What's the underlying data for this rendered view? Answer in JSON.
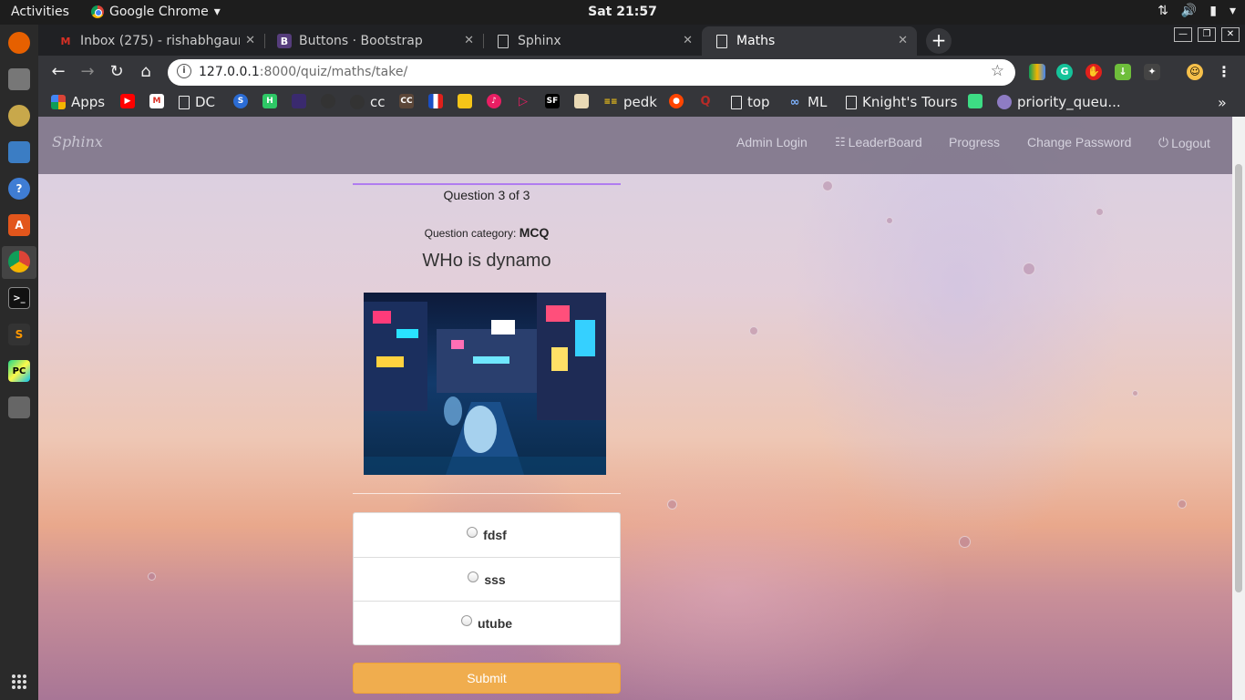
{
  "system": {
    "activities": "Activities",
    "app_menu": "Google Chrome",
    "clock": "Sat 21:57"
  },
  "browser": {
    "tabs": [
      {
        "title": "Inbox (275) - rishabhgaura",
        "icon": "gmail-icon"
      },
      {
        "title": "Buttons · Bootstrap",
        "icon": "bootstrap-icon"
      },
      {
        "title": "Sphinx",
        "icon": "page-icon"
      },
      {
        "title": "Maths",
        "icon": "page-icon"
      }
    ],
    "url_host": "127.0.0.1",
    "url_rest": ":8000/quiz/maths/take/",
    "bookmarks": {
      "apps": "Apps",
      "dc": "DC",
      "cc": "cc",
      "pedk": "pedk",
      "top": "top",
      "ml": "ML",
      "knights": "Knight's Tours",
      "priority": "priority_queu..."
    }
  },
  "site": {
    "brand": "Sphinx",
    "nav": {
      "admin_login": "Admin Login",
      "leaderboard": "LeaderBoard",
      "progress": "Progress",
      "change_password": "Change Password",
      "logout": "Logout"
    }
  },
  "quiz": {
    "question_number": "Question 3 of 3",
    "category_label": "Question category:",
    "category_value": "MCQ",
    "question_text": "WHo is dynamo",
    "answers": [
      "fdsf",
      "sss",
      "utube"
    ],
    "submit_label": "Submit"
  },
  "colors": {
    "accent_rule": "#b07cf0",
    "submit_bg": "#f0ad4e",
    "navbar_bg": "#786e82"
  }
}
